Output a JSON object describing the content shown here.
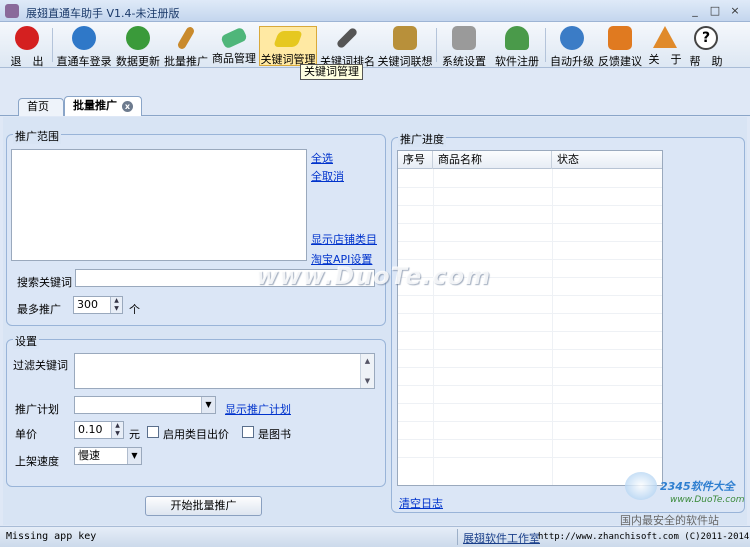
{
  "window": {
    "title": "展翅直通车助手 V1.4-未注册版",
    "controls": [
      "_",
      "□",
      "×"
    ]
  },
  "toolbar": {
    "items": [
      {
        "label": "退　出",
        "icon": "exit-icon",
        "color": "#d42020"
      },
      {
        "label": "直通车登录",
        "icon": "refresh-login-icon",
        "color": "#2f78c8"
      },
      {
        "label": "数据更新",
        "icon": "data-update-icon",
        "color": "#3a9a3a"
      },
      {
        "label": "批量推广",
        "icon": "brush-icon",
        "color": "#c98a2c"
      },
      {
        "label": "商品管理",
        "icon": "eraser-icon",
        "color": "#4fb67a"
      },
      {
        "label": "关键词管理",
        "icon": "note-icon",
        "color": "#e6c820"
      },
      {
        "label": "关键词排名",
        "icon": "telescope-icon",
        "color": "#555555"
      },
      {
        "label": "关键词联想",
        "icon": "thinker-icon",
        "color": "#b8903a"
      },
      {
        "label": "系统设置",
        "icon": "lock-settings-icon",
        "color": "#9a9a9a"
      },
      {
        "label": "软件注册",
        "icon": "user-icon",
        "color": "#4a9a4a"
      },
      {
        "label": "自动升级",
        "icon": "upgrade-icon",
        "color": "#3b7cc6"
      },
      {
        "label": "反馈建议",
        "icon": "feedback-icon",
        "color": "#e07a20"
      },
      {
        "label": "关　于",
        "icon": "home-icon",
        "color": "#e08a2a"
      },
      {
        "label": "帮　助",
        "icon": "help-icon",
        "color": "#444444"
      }
    ],
    "tooltip": "关键词管理"
  },
  "tabs": [
    {
      "label": "首页"
    },
    {
      "label": "批量推广"
    }
  ],
  "scope_group": {
    "title": "推广范围",
    "select_all": "全选",
    "deselect_all": "全取消",
    "show_shop_categories": "显示店铺类目",
    "taobao_api_settings": "淘宝API设置",
    "search_keyword_label": "搜索关键词",
    "search_keyword_value": "",
    "max_promote_label": "最多推广",
    "max_promote_value": "300",
    "max_promote_unit": "个"
  },
  "settings_group": {
    "title": "设置",
    "filter_keywords_label": "过滤关键词",
    "filter_keywords_value": "",
    "plan_label": "推广计划",
    "plan_value": "",
    "show_plan_link": "显示推广计划",
    "price_label": "单价",
    "price_value": "0.10",
    "price_unit": "元",
    "enable_category_bid_label": "启用类目出价",
    "enable_category_bid_checked": false,
    "is_book_label": "是图书",
    "is_book_checked": false,
    "listing_speed_label": "上架速度",
    "listing_speed_value": "慢速"
  },
  "start_button": "开始批量推广",
  "progress_group": {
    "title": "推广进度",
    "columns": [
      "序号",
      "商品名称",
      "状态"
    ],
    "rows": [],
    "clear_log": "清空日志"
  },
  "statusbar": {
    "message": "Missing app key",
    "studio": "展翅软件工作室",
    "url_copyright": "http://www.zhanchisoft.com (C)2011-2014"
  },
  "watermarks": {
    "center": "www.DuoTe.com",
    "corner_site": "www.DuoTe.com",
    "corner_brand": "2345软件大全",
    "corner_slogan": "国内最安全的软件站"
  }
}
